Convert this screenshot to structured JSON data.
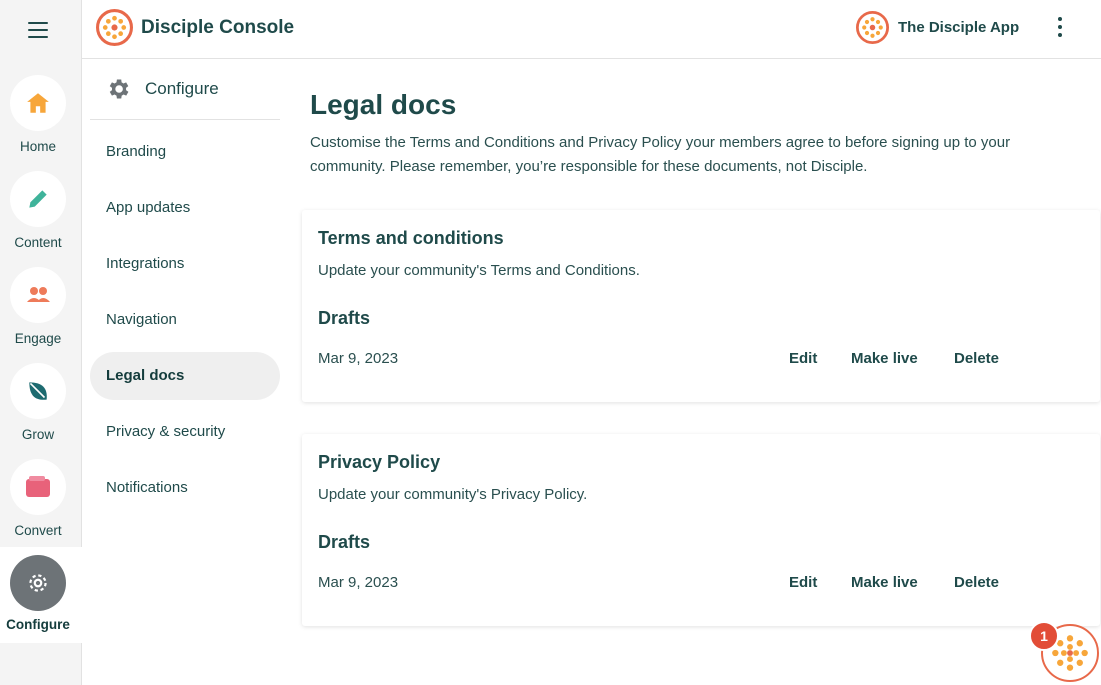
{
  "colors": {
    "accent": "#e8694a",
    "text": "#1f4a4a",
    "active_rail": "#6d7377",
    "badge": "#e24d37"
  },
  "topbar": {
    "brand_title": "Disciple Console",
    "brand_icon": "disciple-logo-icon",
    "app_name": "The Disciple App",
    "menu_icon": "more-vertical-icon"
  },
  "rail": {
    "items": [
      {
        "label": "Home",
        "icon": "home-icon"
      },
      {
        "label": "Content",
        "icon": "pencil-icon"
      },
      {
        "label": "Engage",
        "icon": "people-icon"
      },
      {
        "label": "Grow",
        "icon": "leaf-icon"
      },
      {
        "label": "Convert",
        "icon": "wallet-icon"
      },
      {
        "label": "Configure",
        "icon": "gear-icon",
        "active": true
      }
    ]
  },
  "subnav": {
    "heading": "Configure",
    "items": [
      {
        "label": "Branding"
      },
      {
        "label": "App updates"
      },
      {
        "label": "Integrations"
      },
      {
        "label": "Navigation"
      },
      {
        "label": "Legal docs",
        "active": true
      },
      {
        "label": "Privacy & security"
      },
      {
        "label": "Notifications"
      }
    ]
  },
  "main": {
    "title": "Legal docs",
    "description": "Customise the Terms and Conditions and Privacy Policy your members agree to before signing up to your community. Please remember, you’re responsible for these documents, not Disciple.",
    "cards": [
      {
        "title": "Terms and conditions",
        "description": "Update your community's Terms and Conditions.",
        "section": "Drafts",
        "date": "Mar 9, 2023",
        "actions": {
          "edit": "Edit",
          "make_live": "Make live",
          "delete": "Delete"
        }
      },
      {
        "title": "Privacy Policy",
        "description": "Update your community's Privacy Policy.",
        "section": "Drafts",
        "date": "Mar 9, 2023",
        "actions": {
          "edit": "Edit",
          "make_live": "Make live",
          "delete": "Delete"
        }
      }
    ]
  },
  "widget": {
    "badge_count": "1"
  }
}
